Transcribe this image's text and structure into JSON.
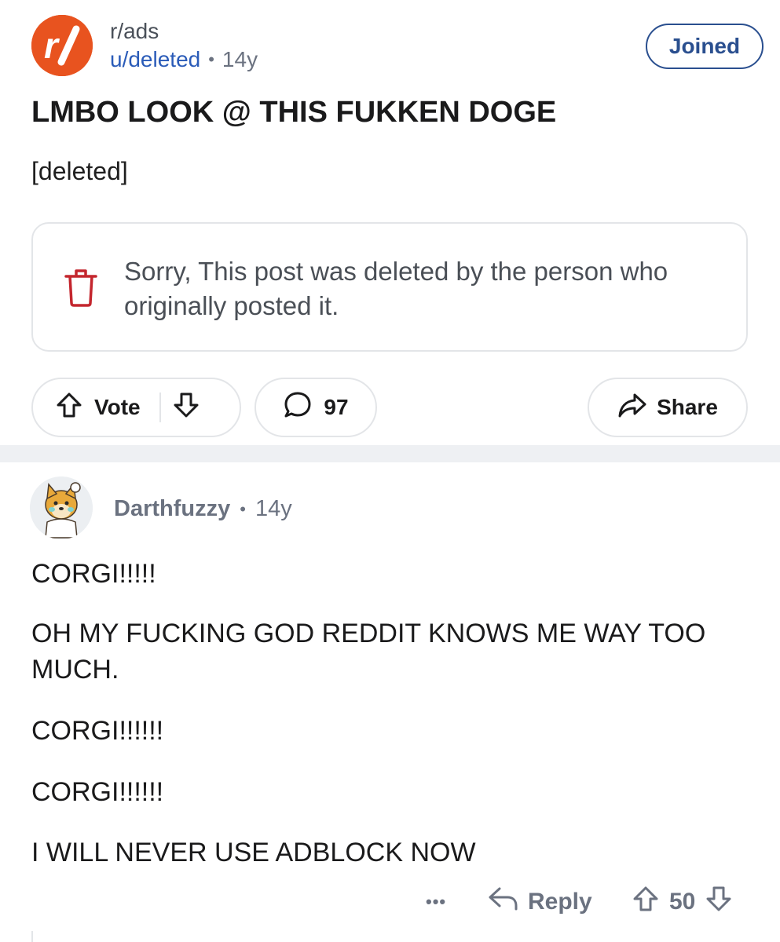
{
  "post": {
    "subreddit": "r/ads",
    "author": "u/deleted",
    "separator": "•",
    "age": "14y",
    "joined_label": "Joined",
    "title": "LMBO LOOK @ THIS FUKKEN DOGE",
    "body": "[deleted]",
    "deleted_notice": "Sorry, This post was deleted by the person who originally posted it.",
    "vote_label": "Vote",
    "comment_count": "97",
    "share_label": "Share"
  },
  "comment": {
    "author": "Darthfuzzy",
    "separator": "•",
    "age": "14y",
    "lines": [
      "CORGI!!!!!",
      "OH MY FUCKING GOD REDDIT KNOWS ME WAY TOO",
      "MUCH.",
      "CORGI!!!!!!",
      "CORGI!!!!!!",
      "I WILL NEVER USE ADBLOCK NOW"
    ],
    "more_label": "•••",
    "reply_label": "Reply",
    "score": "50"
  },
  "colors": {
    "subreddit_icon": "#e8531f",
    "accent_blue": "#2a4f8f",
    "link_blue": "#2a5bb8",
    "trash_red": "#c4262e"
  }
}
